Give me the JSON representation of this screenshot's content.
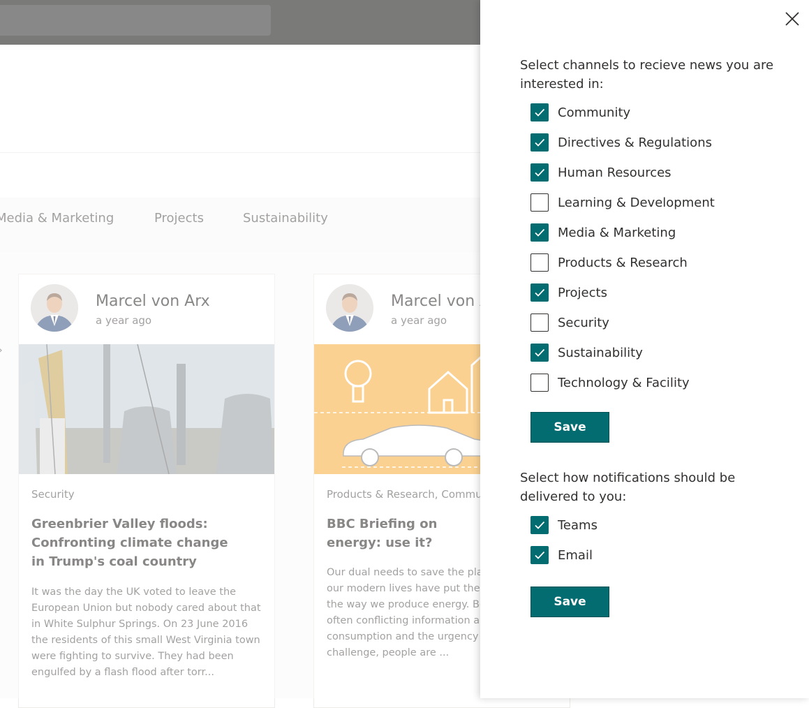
{
  "nav": {
    "items": [
      "Media & Marketing",
      "Projects",
      "Sustainability"
    ]
  },
  "cards": [
    {
      "author": "Marcel von Arx",
      "date": "a year ago",
      "category": "Security",
      "title": "Greenbrier Valley floods: Confronting climate change in Trump's coal country",
      "excerpt": "It was the day the UK voted to leave the European Union but nobody cared about that in White Sulphur Springs. On 23 June 2016 the residents of this small West Virginia town were fighting to survive. They had been engulfed by a flash flood after torr..."
    },
    {
      "author": "Marcel von Arx",
      "date": "a year ago",
      "category": "Products & Research, Community",
      "title": "BBC Briefing on energy: use it?",
      "excerpt": "Our dual needs to save the planet and power our modern lives have put the spotlight on the way we produce energy. Bombarded by often conflicting information about energy consumption and the urgency of our climate challenge, people are ..."
    }
  ],
  "panel": {
    "channels_label": "Select channels to recieve news you are interested in:",
    "channels": [
      {
        "label": "Community",
        "checked": true
      },
      {
        "label": "Directives & Regulations",
        "checked": true
      },
      {
        "label": "Human Resources",
        "checked": true
      },
      {
        "label": "Learning & Development",
        "checked": false
      },
      {
        "label": "Media & Marketing",
        "checked": true
      },
      {
        "label": "Products & Research",
        "checked": false
      },
      {
        "label": "Projects",
        "checked": true
      },
      {
        "label": "Security",
        "checked": false
      },
      {
        "label": "Sustainability",
        "checked": true
      },
      {
        "label": "Technology & Facility",
        "checked": false
      }
    ],
    "save_label": "Save",
    "delivery_label": "Select how notifications should be delivered to you:",
    "delivery": [
      {
        "label": "Teams",
        "checked": true
      },
      {
        "label": "Email",
        "checked": true
      }
    ],
    "save2_label": "Save"
  },
  "colors": {
    "accent": "#036c70",
    "text": "#323130",
    "secondary_text": "#605e5c"
  }
}
